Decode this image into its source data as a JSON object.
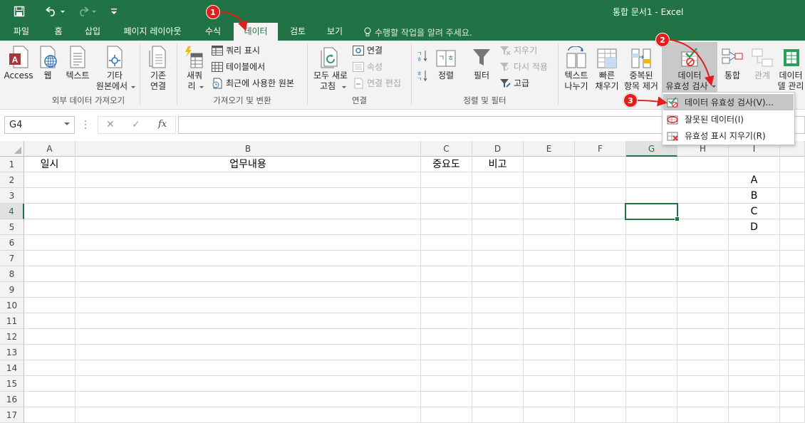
{
  "window": {
    "title": "통합 문서1 - Excel"
  },
  "theme": {
    "accent": "#217346",
    "callout": "#e0201c"
  },
  "tabs": [
    {
      "label": "파일"
    },
    {
      "label": "홈"
    },
    {
      "label": "삽입"
    },
    {
      "label": "페이지 레이아웃"
    },
    {
      "label": "수식"
    },
    {
      "label": "데이터",
      "active": true
    },
    {
      "label": "검토"
    },
    {
      "label": "보기"
    }
  ],
  "tell_me": "수행할 작업을 알려 주세요.",
  "ribbon": {
    "external": {
      "label": "외부 데이터 가져오기",
      "access": "Access",
      "web": "웹",
      "text": "텍스트",
      "other_1": "기타",
      "other_2": "원본에서",
      "existing_1": "기존",
      "existing_2": "연결"
    },
    "transform": {
      "label": "가져오기 및 변환",
      "new_query_1": "새쿼",
      "new_query_2": "리",
      "show_queries": "쿼리 표시",
      "from_table": "테이블에서",
      "recent_sources": "최근에 사용한 원본"
    },
    "connections": {
      "label": "연결",
      "refresh_1": "모두 새로",
      "refresh_2": "고침",
      "connections": "연결",
      "properties": "속성",
      "edit_links": "연결 편집"
    },
    "sort_filter": {
      "label": "정렬 및 필터",
      "sort": "정렬",
      "filter": "필터",
      "clear": "지우기",
      "reapply": "다시 적용",
      "advanced": "고급"
    },
    "data_tools": {
      "text_to_cols_1": "텍스트",
      "text_to_cols_2": "나누기",
      "flash_fill_1": "빠른",
      "flash_fill_2": "채우기",
      "remove_dup_1": "중복된",
      "remove_dup_2": "항목 제거",
      "validation_1": "데이터",
      "validation_2": "유효성 검사",
      "consolidate": "통합",
      "relationships": "관계",
      "model_1": "데이터",
      "model_2": "델 관리"
    }
  },
  "namebox": "G4",
  "formula_buttons": {
    "cancel": "✕",
    "enter": "✓",
    "fx": "fx"
  },
  "columns": [
    "A",
    "B",
    "C",
    "D",
    "E",
    "F",
    "G",
    "H",
    "I"
  ],
  "rows": [
    "1",
    "2",
    "3",
    "4",
    "5",
    "6",
    "7",
    "8",
    "9",
    "10",
    "11",
    "12",
    "13",
    "14",
    "15",
    "16",
    "17"
  ],
  "cells": {
    "A1": "일시",
    "B1": "업무내용",
    "C1": "중요도",
    "D1": "비고",
    "I2": "A",
    "I3": "B",
    "I4": "C",
    "I5": "D"
  },
  "dropdown": {
    "validation": "데이터 유효성 검사(V)...",
    "circle_invalid": "잘못된 데이터(I)",
    "clear_circles": "유효성 표시 지우기(R)"
  },
  "callouts": [
    "1",
    "2",
    "3"
  ]
}
